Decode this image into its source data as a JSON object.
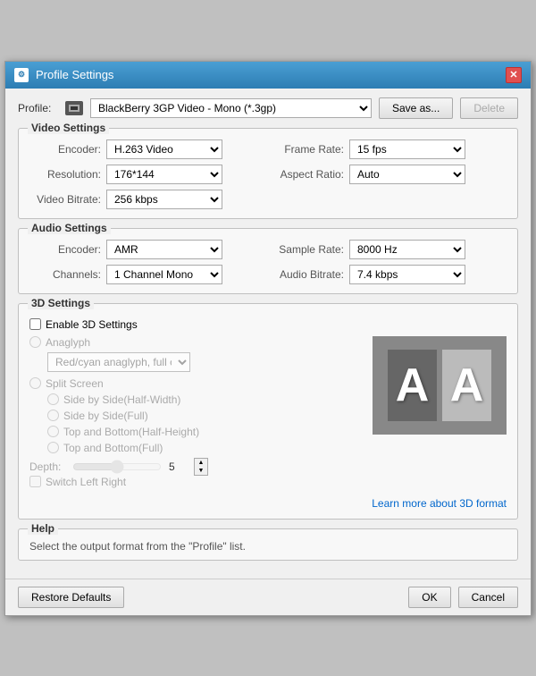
{
  "dialog": {
    "title": "Profile Settings",
    "icon": "⚙",
    "close_label": "✕"
  },
  "profile": {
    "label": "Profile:",
    "value": "BlackBerry 3GP Video - Mono (*.3gp)",
    "save_as_label": "Save as...",
    "delete_label": "Delete"
  },
  "video_settings": {
    "title": "Video Settings",
    "encoder_label": "Encoder:",
    "encoder_value": "H.263 Video",
    "resolution_label": "Resolution:",
    "resolution_value": "176*144",
    "video_bitrate_label": "Video Bitrate:",
    "video_bitrate_value": "256 kbps",
    "frame_rate_label": "Frame Rate:",
    "frame_rate_value": "15 fps",
    "aspect_ratio_label": "Aspect Ratio:",
    "aspect_ratio_value": "Auto"
  },
  "audio_settings": {
    "title": "Audio Settings",
    "encoder_label": "Encoder:",
    "encoder_value": "AMR",
    "channels_label": "Channels:",
    "channels_value": "1 Channel Mono",
    "sample_rate_label": "Sample Rate:",
    "sample_rate_value": "8000 Hz",
    "audio_bitrate_label": "Audio Bitrate:",
    "audio_bitrate_value": "7.4 kbps"
  },
  "settings_3d": {
    "title": "3D Settings",
    "enable_label": "Enable 3D Settings",
    "anaglyph_label": "Anaglyph",
    "anaglyph_value": "Red/cyan anaglyph, full color",
    "split_screen_label": "Split Screen",
    "side_by_side_half_label": "Side by Side(Half-Width)",
    "side_by_side_full_label": "Side by Side(Full)",
    "top_bottom_half_label": "Top and Bottom(Half-Height)",
    "top_bottom_full_label": "Top and Bottom(Full)",
    "depth_label": "Depth:",
    "depth_value": "5",
    "switch_lr_label": "Switch Left Right",
    "learn_more_label": "Learn more about 3D format",
    "preview_letter": "AA"
  },
  "help": {
    "title": "Help",
    "text": "Select the output format from the \"Profile\" list."
  },
  "footer": {
    "restore_label": "Restore Defaults",
    "ok_label": "OK",
    "cancel_label": "Cancel"
  }
}
